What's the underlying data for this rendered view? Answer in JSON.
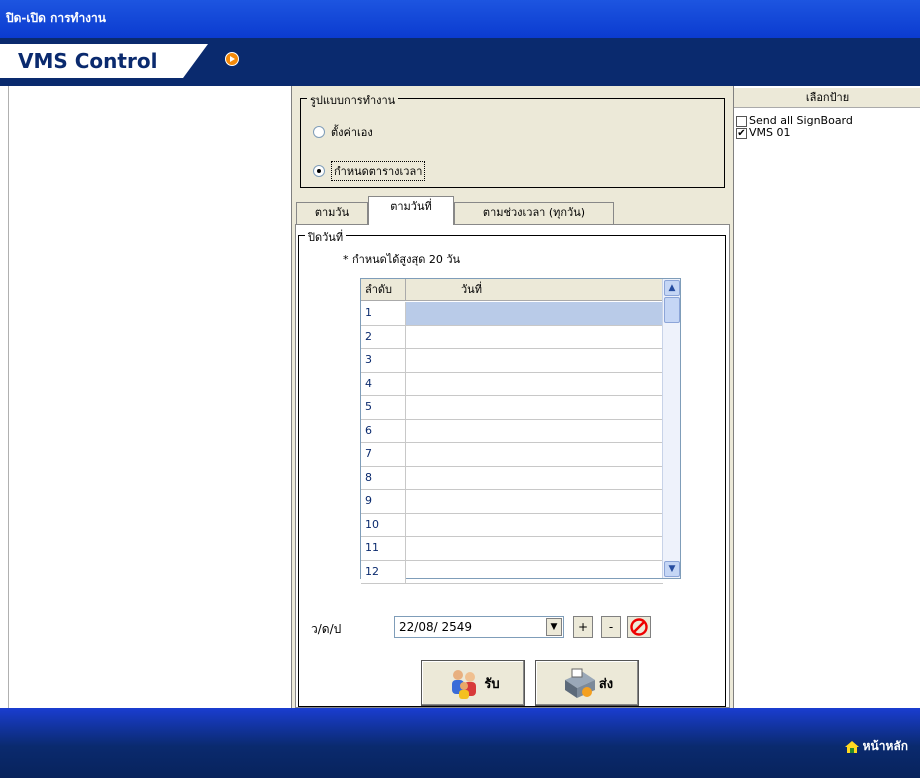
{
  "window": {
    "title": "ปิด-เปิด การทำงาน"
  },
  "header": {
    "brand": "VMS Control"
  },
  "mode_group": {
    "caption": "รูปแบบการทำงาน",
    "options": [
      {
        "label": "ตั้งค่าเอง",
        "selected": false
      },
      {
        "label": "กำหนดตารางเวลา",
        "selected": true
      }
    ]
  },
  "tabs": [
    {
      "label": "ตามวัน",
      "active": false
    },
    {
      "label": "ตามวันที่",
      "active": true
    },
    {
      "label": "ตามช่วงเวลา (ทุกวัน)",
      "active": false
    }
  ],
  "close_dates": {
    "caption": "ปิดวันที่",
    "note": "* กำหนดได้สูงสุด 20 วัน",
    "columns": [
      "ลำดับ",
      "วันที่"
    ],
    "rows": [
      "1",
      "2",
      "3",
      "4",
      "5",
      "6",
      "7",
      "8",
      "9",
      "10",
      "11",
      "12"
    ],
    "selected_row": 1
  },
  "date_input": {
    "label": "ว/ด/ป",
    "value": "22/08/ 2549"
  },
  "buttons": {
    "add": "+",
    "remove": "-",
    "receive": "รับ",
    "send": "ส่ง"
  },
  "sign_panel": {
    "header": "เลือกป้าย",
    "items": [
      {
        "label": "Send all SignBoard",
        "checked": false
      },
      {
        "label": "VMS 01",
        "checked": true
      }
    ]
  },
  "footer": {
    "home": "หน้าหลัก"
  },
  "colors": {
    "navy": "#0a2a6e",
    "title_blue": "#1d55e0",
    "accent_orange": "#f58a0a",
    "selection": "#b9cbe8"
  },
  "icons": [
    "play-icon",
    "people-icon",
    "printer-icon",
    "cancel-icon",
    "home-icon",
    "chevron-down-icon",
    "scroll-up-icon",
    "scroll-down-icon"
  ]
}
